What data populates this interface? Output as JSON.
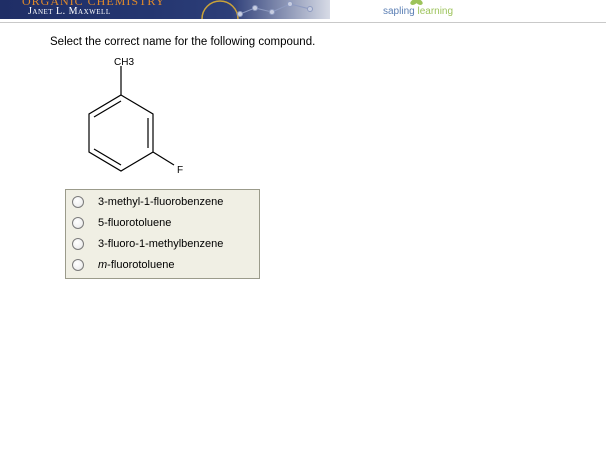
{
  "header": {
    "book_title": "ORGANIC CHEMISTRY",
    "author": "Janet L. Maxwell",
    "brand_part1": "sapling ",
    "brand_part2": "learning"
  },
  "question": {
    "prompt": "Select the correct name for the following compound.",
    "structure_labels": {
      "methyl": "CH3",
      "fluoro": "F"
    }
  },
  "options": [
    {
      "prefix": "",
      "label": "3-methyl-1-fluorobenzene",
      "selected": false
    },
    {
      "prefix": "",
      "label": "5-fluorotoluene",
      "selected": false
    },
    {
      "prefix": "",
      "label": "3-fluoro-1-methylbenzene",
      "selected": false
    },
    {
      "prefix": "m",
      "label": "-fluorotoluene",
      "selected": false
    }
  ],
  "colors": {
    "banner": "#243670",
    "title_orange": "#e08a2a",
    "brand_blue": "#5b7fb4",
    "brand_green": "#9cc35a",
    "options_bg": "#f0efe4"
  }
}
